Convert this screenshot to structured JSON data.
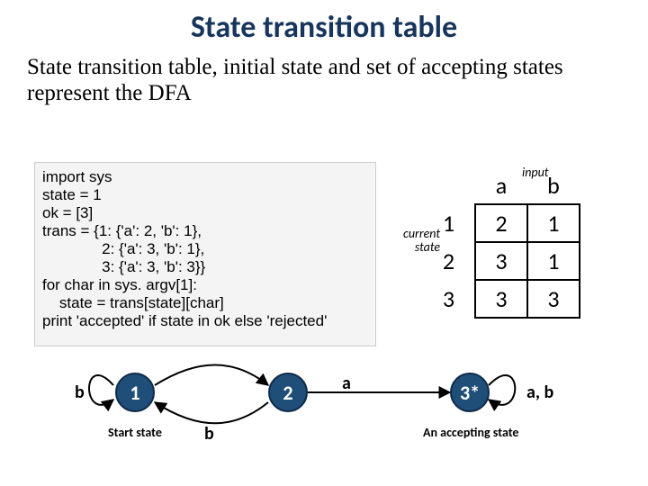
{
  "title": "State transition table",
  "subtitle": "State transition table, initial state and set of accepting states represent the DFA",
  "code": "import sys\nstate = 1\nok = [3]\ntrans = {1: {'a': 2, 'b': 1},\n              2: {'a': 3, 'b': 1},\n              3: {'a': 3, 'b': 3}}\nfor char in sys. argv[1]:\n    state = trans[state][char]\nprint 'accepted' if state in ok else 'rejected'",
  "table": {
    "input_label": "input",
    "state_label_l1": "current",
    "state_label_l2": "state",
    "col_headers": [
      "a",
      "b"
    ],
    "rows": [
      {
        "state": "1",
        "cells": [
          "2",
          "1"
        ]
      },
      {
        "state": "2",
        "cells": [
          "3",
          "1"
        ]
      },
      {
        "state": "3",
        "cells": [
          "3",
          "3"
        ]
      }
    ]
  },
  "diagram": {
    "nodes": {
      "n1": "1",
      "n2": "2",
      "n3": "3*"
    },
    "edge_labels": {
      "loop_b": "b",
      "to2": "a",
      "back_b": "b",
      "to3_a": "a",
      "loop_ab": "a, b"
    },
    "captions": {
      "start": "Start state",
      "accepting": "An accepting state"
    }
  }
}
